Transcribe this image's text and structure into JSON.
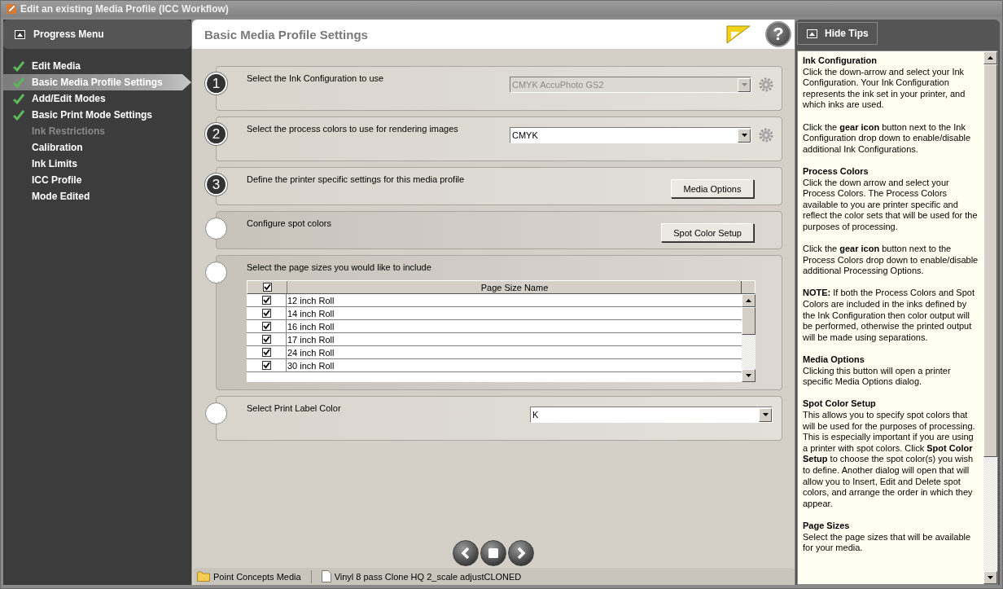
{
  "window": {
    "title": "Edit an existing Media Profile (ICC Workflow)"
  },
  "sidebar": {
    "title": "Progress Menu",
    "items": [
      {
        "label": "Edit Media",
        "done": true,
        "selected": false,
        "disabled": false
      },
      {
        "label": "Basic Media Profile Settings",
        "done": true,
        "selected": true,
        "disabled": false
      },
      {
        "label": "Add/Edit Modes",
        "done": true,
        "selected": false,
        "disabled": false
      },
      {
        "label": "Basic Print Mode Settings",
        "done": true,
        "selected": false,
        "disabled": false
      },
      {
        "label": "Ink Restrictions",
        "done": false,
        "selected": false,
        "disabled": true
      },
      {
        "label": "Calibration",
        "done": false,
        "selected": false,
        "disabled": false
      },
      {
        "label": "Ink Limits",
        "done": false,
        "selected": false,
        "disabled": false
      },
      {
        "label": "ICC Profile",
        "done": false,
        "selected": false,
        "disabled": false
      },
      {
        "label": "Mode Edited",
        "done": false,
        "selected": false,
        "disabled": false
      }
    ]
  },
  "header": {
    "title": "Basic Media Profile Settings",
    "help_label": "?"
  },
  "steps": [
    {
      "number": "1",
      "label": "Select the Ink Configuration to use",
      "kind": "dropdown",
      "value": "CMYK AccuPhoto GS2",
      "disabled": true,
      "gear": true
    },
    {
      "number": "2",
      "label": "Select the process colors to use for rendering images",
      "kind": "dropdown",
      "value": "CMYK",
      "disabled": false,
      "gear": true
    },
    {
      "number": "3",
      "label": "Define the printer specific settings for this media profile",
      "kind": "button",
      "button": "Media Options"
    },
    {
      "label": "Configure spot colors",
      "kind": "button",
      "button": "Spot Color Setup"
    },
    {
      "label": "Select the page sizes you would like to include",
      "kind": "table",
      "all_checked": true,
      "column": "Page Size Name",
      "rows": [
        {
          "name": "12 inch Roll",
          "checked": true
        },
        {
          "name": "14 inch Roll",
          "checked": true
        },
        {
          "name": "16 inch Roll",
          "checked": true
        },
        {
          "name": "17 inch Roll",
          "checked": true
        },
        {
          "name": "24 inch Roll",
          "checked": true
        },
        {
          "name": "30 inch Roll",
          "checked": true
        }
      ]
    },
    {
      "label": "Select Print Label Color",
      "kind": "dropdown",
      "value": "K",
      "disabled": false,
      "gear": false
    }
  ],
  "status_bar": {
    "folder": "Point Concepts Media",
    "file": "Vinyl 8 pass Clone HQ 2_scale adjustCLONED"
  },
  "tips": {
    "button": "Hide Tips",
    "items": [
      {
        "kind": "heading",
        "text": "**Ink Configuration**"
      },
      {
        "kind": "paragraph",
        "text": "Click the down-arrow and select your Ink Configuration. Your Ink Configuration represents the ink set in your printer, and which inks are used."
      },
      {
        "kind": "paragraph",
        "text": "Click the **gear icon** button next to the Ink Configuration drop down to enable/disable additional Ink Configurations."
      },
      {
        "kind": "heading",
        "text": "**Process Colors**"
      },
      {
        "kind": "paragraph",
        "text": "Click the down arrow and select your Process Colors. The Process Colors available to you are printer specific and reflect the color sets that will be used for the purposes of processing."
      },
      {
        "kind": "paragraph",
        "text": "Click the **gear icon** button next to the Process Colors drop down to enable/disable additional Processing Options."
      },
      {
        "kind": "paragraph",
        "text": "**NOTE:** If both the Process Colors and Spot Colors are included in the inks defined by the Ink Configuration then color output will be performed, otherwise the printed output will be made using separations."
      },
      {
        "kind": "heading",
        "text": "**Media Options**"
      },
      {
        "kind": "paragraph",
        "text": "Clicking this button will open a printer specific Media Options dialog."
      },
      {
        "kind": "heading",
        "text": "**Spot Color Setup**"
      },
      {
        "kind": "paragraph",
        "text": "This allows you to specify spot colors that will be used for the purposes of processing. This is especially important if you are using a printer with spot colors. Click **Spot Color Setup** to choose the spot color(s) you wish to define. Another dialog will open that will allow you to Insert, Edit and Delete spot colors, and arrange the order in which they appear."
      },
      {
        "kind": "heading",
        "text": "**Page Sizes**"
      },
      {
        "kind": "paragraph",
        "text": "Select the page sizes that will be available for your media."
      }
    ]
  }
}
